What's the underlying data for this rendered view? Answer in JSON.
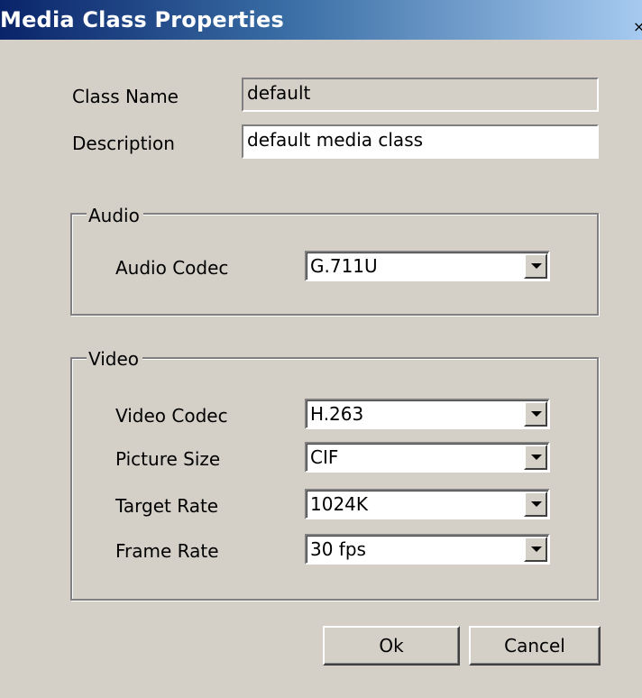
{
  "window": {
    "title": "Media Class Properties",
    "close_glyph": "×"
  },
  "form": {
    "class_name_label": "Class Name",
    "class_name_value": "default",
    "description_label": "Description",
    "description_value": "default media class"
  },
  "audio": {
    "legend": "Audio",
    "codec_label": "Audio Codec",
    "codec_value": "G.711U"
  },
  "video": {
    "legend": "Video",
    "codec_label": "Video Codec",
    "codec_value": "H.263",
    "picture_size_label": "Picture Size",
    "picture_size_value": "CIF",
    "target_rate_label": "Target Rate",
    "target_rate_value": "1024K",
    "frame_rate_label": "Frame Rate",
    "frame_rate_value": "30 fps"
  },
  "buttons": {
    "ok": "Ok",
    "cancel": "Cancel"
  },
  "icons": {
    "dropdown": "chevron-down-icon",
    "close": "close-icon"
  }
}
